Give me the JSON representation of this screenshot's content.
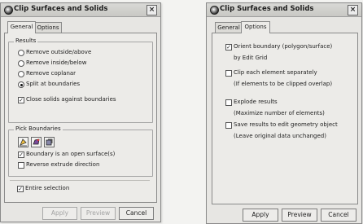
{
  "dialog_left": {
    "title": "Clip Surfaces and Solids",
    "close": "×",
    "tabs": [
      "General",
      "Options"
    ],
    "results": {
      "label": "Results",
      "options": [
        "Remove outside/above",
        "Remove inside/below",
        "Remove coplanar",
        "Split at boundaries"
      ],
      "selected_index": 3,
      "close_solids_label": "Close solids against boundaries",
      "close_solids_checked": true
    },
    "pick": {
      "label": "Pick Boundaries",
      "open_surface_label": "Boundary is an open surface(s)",
      "open_surface_checked": true,
      "reverse_label": "Reverse extrude direction",
      "reverse_checked": false
    },
    "entire_selection_label": "Entire selection",
    "entire_selection_checked": true,
    "buttons": {
      "apply": "Apply",
      "preview": "Preview",
      "cancel": "Cancel"
    }
  },
  "dialog_right": {
    "title": "Clip Surfaces and Solids",
    "close": "×",
    "tabs": [
      "General",
      "Options"
    ],
    "options": [
      {
        "label": "Orient boundary (polygon/surface)",
        "sub": "by Edit Grid",
        "checked": true
      },
      {
        "label": "Clip each element separately",
        "sub": "(If elements to be clipped overlap)",
        "checked": false
      },
      {
        "label": "Explode results",
        "sub": "(Maximize number of elements)",
        "checked": false
      },
      {
        "label": "Save results to edit geometry object",
        "sub": "(Leave original data unchanged)",
        "checked": false
      }
    ],
    "buttons": {
      "apply": "Apply",
      "preview": "Preview",
      "cancel": "Cancel"
    }
  },
  "icons": [
    "app-globe-icon",
    "pick-surface-icon",
    "pick-solid-icon",
    "pick-polygon-icon",
    "close-icon"
  ],
  "check_mark": "✓"
}
